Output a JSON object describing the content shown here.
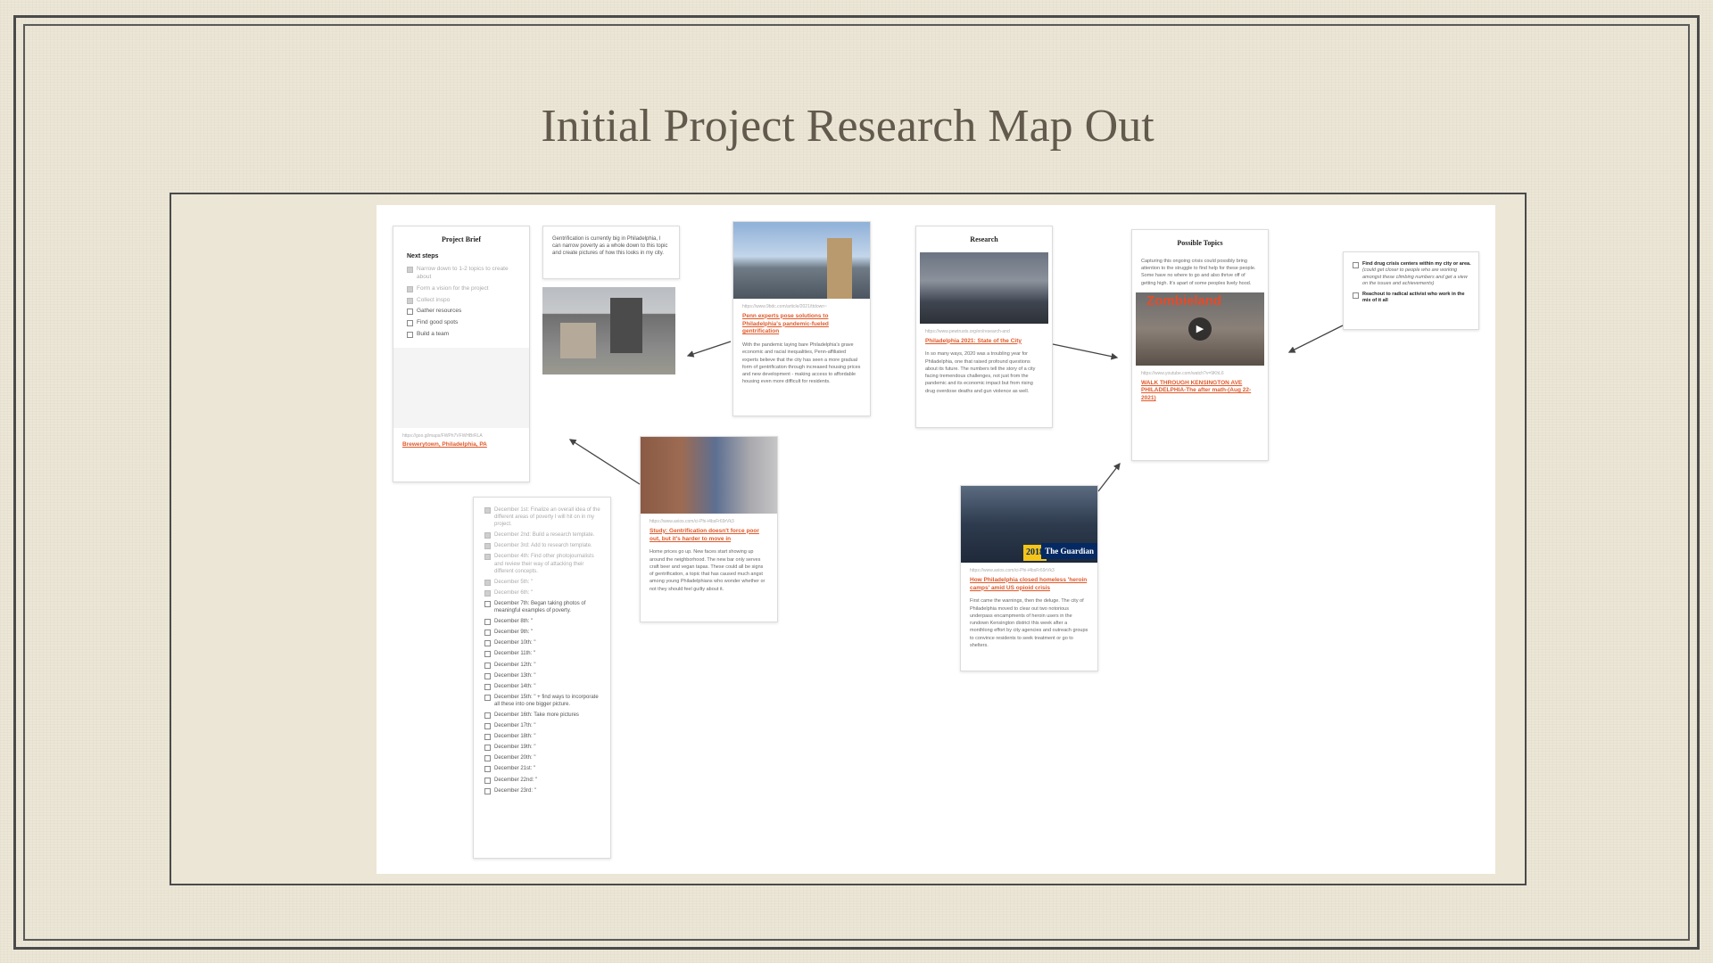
{
  "title": "Initial Project Research Map Out",
  "brief": {
    "heading": "Project Brief",
    "next_steps": "Next steps",
    "items": [
      {
        "text": "Narrow down to 1-2 topics to create about",
        "done": true
      },
      {
        "text": "Form a vision for the project",
        "done": true
      },
      {
        "text": "Collect inspo",
        "done": true
      },
      {
        "text": "Gather resources",
        "done": false
      },
      {
        "text": "Find good spots",
        "done": false
      },
      {
        "text": "Build a team",
        "done": false
      }
    ],
    "url": "https://goo.gl/maps/FWPh7VFWHBrRLA",
    "link": "Brewerytown, Philadelphia, PA"
  },
  "note_gentrification": "Gentrification is currently big in Philadelphia, I can narrow poverty as a whole down to this topic and create pictures of how this looks in my city.",
  "penn": {
    "url": "https://www.9bdc.com/article/2021/ttdown~",
    "link": "Penn experts pose solutions to Philadelphia's pandemic-fueled gentrification",
    "desc": "With the pandemic laying bare Philadelphia's grave economic and racial inequalities, Penn-affiliated experts believe that the city has seen a more gradual form of gentrification through increased housing prices and new development - making access to affordable housing even more difficult for residents."
  },
  "research": {
    "heading": "Research",
    "url": "https://www.pewtrusts.org/en/research-and",
    "link": "Philadelphia 2021: State of the City",
    "desc": "In so many ways, 2020 was a troubling year for Philadelphia, one that raised profound questions about its future. The numbers tell the story of a city facing tremendous challenges, not just from the pandemic and its economic impact but from rising drug overdose deaths and gun violence as well."
  },
  "topics": {
    "heading": "Possible Topics",
    "desc": "Capturing this ongoing crisis could possibly bring attention to the struggle to find help for these people. Some have no where to go and also thrive off of getting high. It's apart of some peoples lively hood.",
    "video_badge": "Zombieland",
    "url": "https://www.youtube.com/watch?v=9KhL6",
    "link": "WALK THROUGH KENSINGTON AVE PHILADELPHIA-The after math-(Aug 22-2021)"
  },
  "todos": [
    {
      "text": "Find drug crisis centers within my city or area.",
      "note": "(could get closer to people who are working amongst these climbing numbers and get a view on the issues and achievements)"
    },
    {
      "text": "Reachout to radical activist who work in the mix of it all",
      "note": ""
    }
  ],
  "study": {
    "url": "https://www.axios.com/ci-Phi-i4bsFr69rVk3",
    "link": "Study: Gentrification doesn't force poor out, but it's harder to move in",
    "desc": "Home prices go up. New faces start showing up around the neighborhood. The new bar only serves craft beer and vegan tapas. These could all be signs of gentrification, a topic that has caused much angst among young Philadelphians who wonder whether or not they should feel guilty about it."
  },
  "guardian": {
    "year": "2018",
    "brand": "The Guardian",
    "url": "https://www.axios.com/ci-Phi-i4bsFr69rVk3",
    "link": "How Philadelphia closed homeless 'heroin camps' amid US opioid crisis",
    "desc": "First came the warnings, then the deluge. The city of Philadelphia moved to clear out two notorious underpass encampments of heroin users in the rundown Kensington district this week after a monthlong effort by city agencies and outreach groups to convince residents to seek treatment or go to shelters."
  },
  "december": [
    {
      "text": "December 1st: Finalize an overall idea of the different areas of poverty I will hit on in my project.",
      "done": true
    },
    {
      "text": "December 2nd: Build a research template.",
      "done": true
    },
    {
      "text": "December 3rd: Add to research template.",
      "done": true
    },
    {
      "text": "December 4th: Find other photojournalists and review their way of attacking their different concepts.",
      "done": true
    },
    {
      "text": "December 5th: \"",
      "done": true
    },
    {
      "text": "December 6th: \"",
      "done": true
    },
    {
      "text": "December 7th: Began taking photos of meaningful examples of poverty.",
      "done": false
    },
    {
      "text": "December 8th: \"",
      "done": false
    },
    {
      "text": "December 9th: \"",
      "done": false
    },
    {
      "text": "December 10th: \"",
      "done": false
    },
    {
      "text": "December 11th: \"",
      "done": false
    },
    {
      "text": "December 12th: \"",
      "done": false
    },
    {
      "text": "December 13th: \"",
      "done": false
    },
    {
      "text": "December 14th: \"",
      "done": false
    },
    {
      "text": "December 15th: \" + find ways to incorporate all these into one bigger picture.",
      "done": false
    },
    {
      "text": "December 16th: Take more pictures",
      "done": false
    },
    {
      "text": "December 17th: \"",
      "done": false
    },
    {
      "text": "December 18th: \"",
      "done": false
    },
    {
      "text": "December 19th: \"",
      "done": false
    },
    {
      "text": "December 20th: \"",
      "done": false
    },
    {
      "text": "December 21st: \"",
      "done": false
    },
    {
      "text": "December 22nd: \"",
      "done": false
    },
    {
      "text": "December 23rd: \"",
      "done": false
    }
  ]
}
